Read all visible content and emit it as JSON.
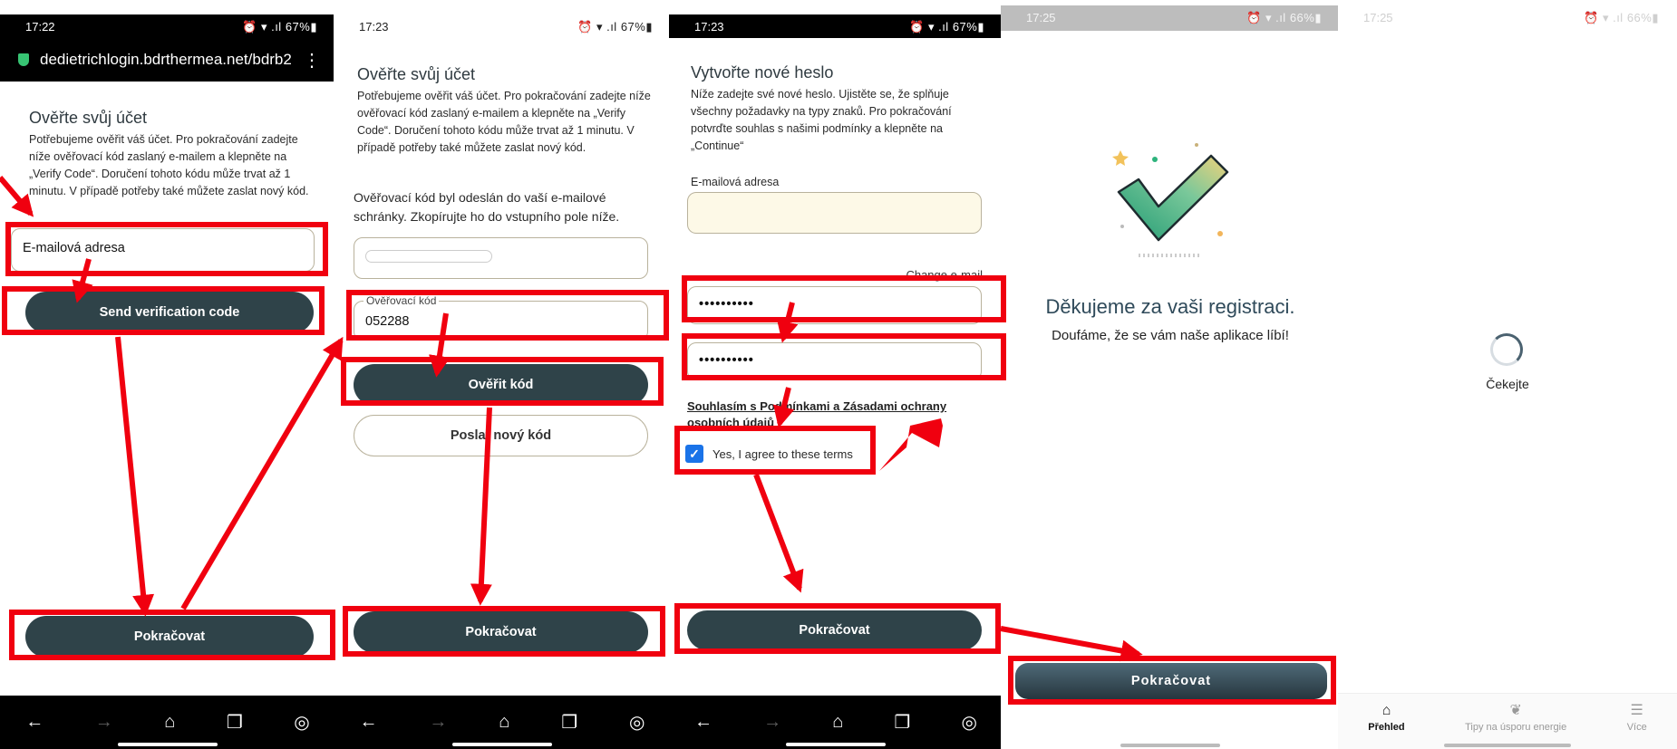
{
  "colors": {
    "annotation_red": "#f0000f",
    "button_dark": "#2f4349",
    "checkbox_blue": "#1a73e8"
  },
  "screen1": {
    "status_time": "17:22",
    "status_right": "67%",
    "url": "dedietrichlogin.bdrthermea.net/bdrb2",
    "title": "Ověřte svůj účet",
    "description": "Potřebujeme ověřit váš účet. Pro pokračování zadejte níže ověřovací kód zaslaný e-mailem a klepněte na „Verify Code“. Doručení tohoto kódu může trvat až 1 minutu. V případě potřeby také můžete zaslat nový kód.",
    "email_placeholder": "E-mailová adresa",
    "send_button": "Send verification code",
    "continue_button": "Pokračovat"
  },
  "screen2": {
    "status_time": "17:23",
    "status_right": "67%",
    "title": "Ověřte svůj účet",
    "description": "Potřebujeme ověřit váš účet. Pro pokračování zadejte níže ověřovací kód zaslaný e-mailem a klepněte na „Verify Code“. Doručení tohoto kódu může trvat až 1 minutu. V případě potřeby také můžete zaslat nový kód.",
    "sent_message": "Ověřovací kód byl odeslán do vaší e-mailové schránky. Zkopírujte ho do vstupního pole níže.",
    "code_label": "Ověřovací kód",
    "code_value": "052288",
    "verify_button": "Ověřit kód",
    "resend_button": "Poslat nový kód",
    "continue_button": "Pokračovat"
  },
  "screen3": {
    "status_time": "17:23",
    "status_right": "67%",
    "title": "Vytvořte nové heslo",
    "description": "Níže zadejte své nové heslo. Ujistěte se, že splňuje všechny požadavky na typy znaků. Pro pokračování potvrďte souhlas s našimi podmínky a klepněte na „Continue“",
    "email_label": "E-mailová adresa",
    "change_email": "Change e-mail",
    "password_mask": "••••••••••",
    "confirm_mask": "••••••••••",
    "terms_link": "Souhlasím s Podmínkami a Zásadami ochrany osobních údajů",
    "agree_label": "Yes, I agree to these terms",
    "continue_button": "Pokračovat"
  },
  "screen4": {
    "status_time": "17:25",
    "status_right": "66%",
    "thanks_title": "Děkujeme za vaši registraci.",
    "thanks_sub": "Doufáme, že se vám naše aplikace líbí!",
    "continue_button": "Pokračovat"
  },
  "screen5": {
    "status_time": "17:25",
    "status_right": "66%",
    "wait_text": "Čekejte",
    "nav": [
      "Přehled",
      "Tipy na úsporu energie",
      "Více"
    ]
  }
}
